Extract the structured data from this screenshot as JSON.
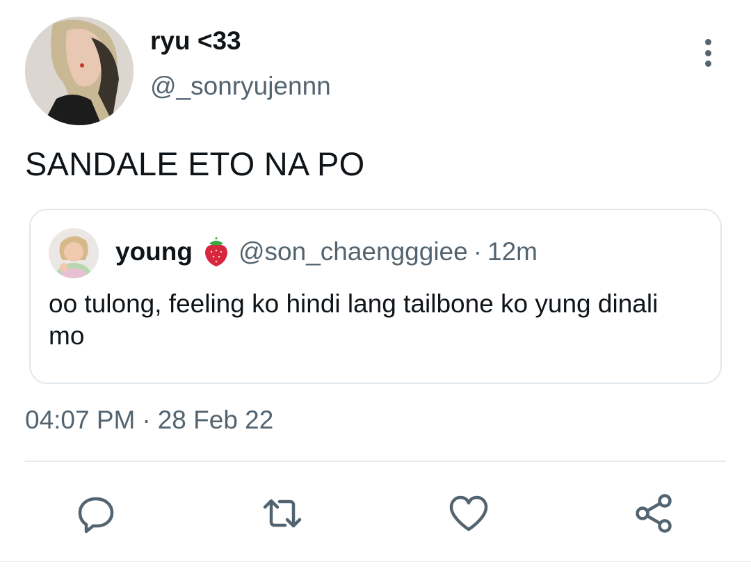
{
  "tweet": {
    "author": {
      "display_name": "ryu <33",
      "handle": "@_sonryujennn",
      "avatar": "profile-photo"
    },
    "more_icon": "more-vertical-icon",
    "text": "SANDALE ETO NA PO",
    "quoted": {
      "display_name": "young",
      "emoji": "strawberry",
      "handle": "@son_chaengggiee",
      "separator": "·",
      "time": "12m",
      "text": "oo tulong, feeling ko hindi lang tailbone ko yung dinali mo"
    },
    "time": "04:07 PM",
    "separator": "·",
    "date": "28 Feb 22"
  },
  "actions": [
    {
      "icon": "reply-icon"
    },
    {
      "icon": "retweet-icon"
    },
    {
      "icon": "like-icon"
    },
    {
      "icon": "share-icon"
    }
  ],
  "colors": {
    "text": "#0f1419",
    "secondary": "#536471",
    "border": "#e1e8ed"
  }
}
